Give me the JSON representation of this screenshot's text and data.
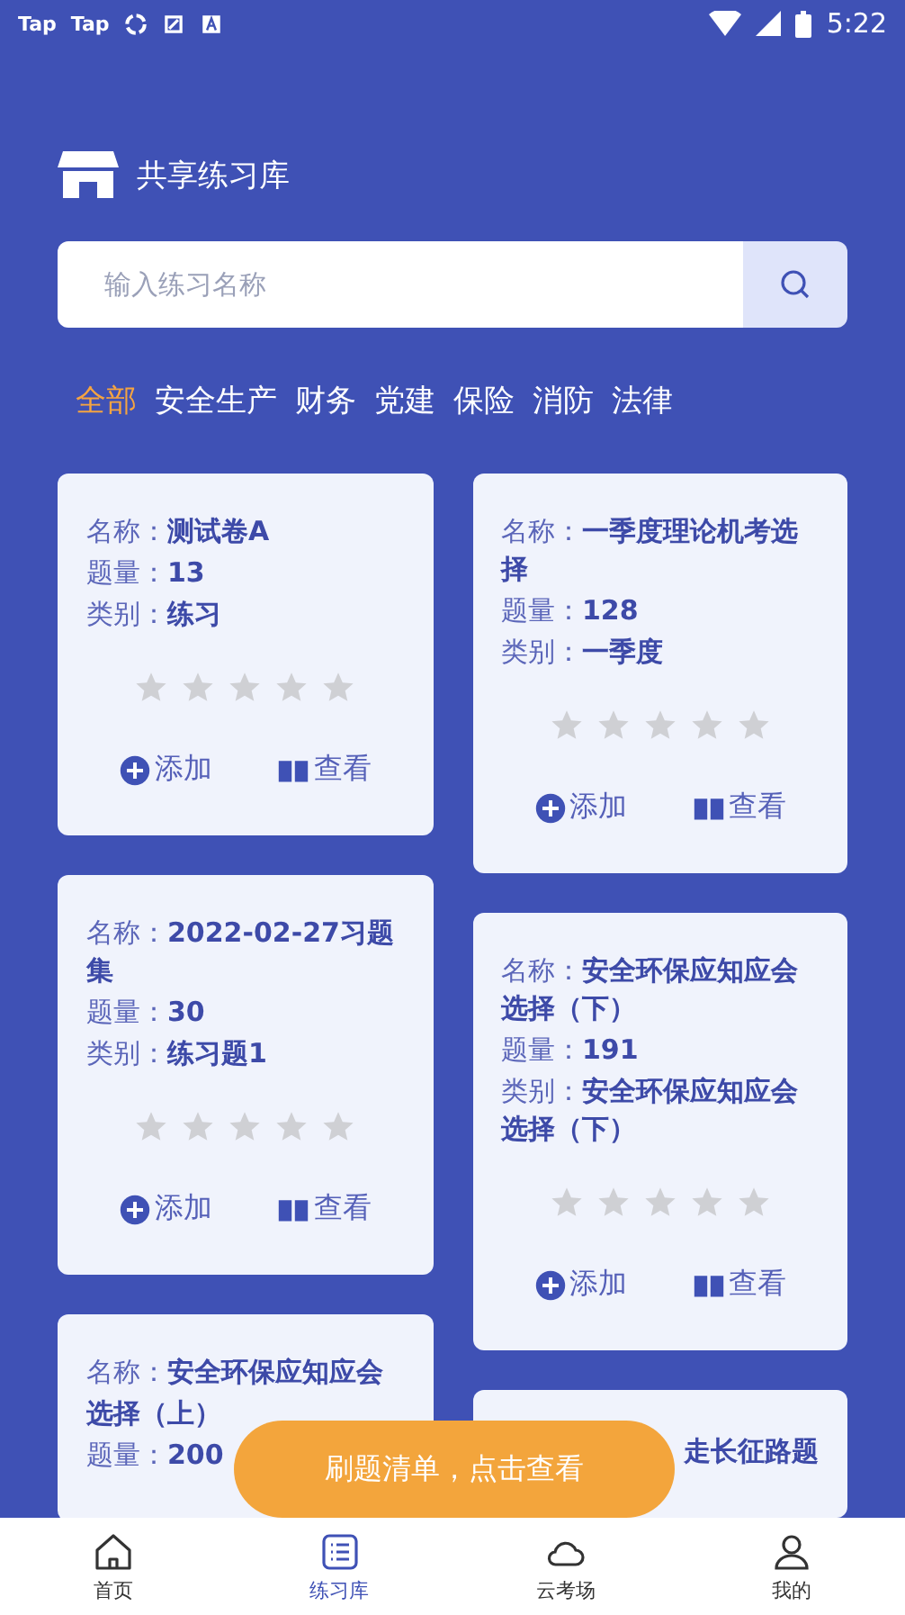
{
  "status_bar": {
    "left": [
      "Tap",
      "Tap"
    ],
    "time": "5:22"
  },
  "header": {
    "title": "共享练习库"
  },
  "search": {
    "placeholder": "输入练习名称"
  },
  "filters": [
    {
      "label": "全部",
      "selected": true
    },
    {
      "label": "安全生产",
      "selected": false
    },
    {
      "label": "财务",
      "selected": false
    },
    {
      "label": "党建",
      "selected": false
    },
    {
      "label": "保险",
      "selected": false
    },
    {
      "label": "消防",
      "selected": false
    },
    {
      "label": "法律",
      "selected": false
    }
  ],
  "cards": [
    {
      "kind": "full",
      "lines": [
        "名称：**测试卷A**",
        "题量：**13**",
        "类别：**练习**"
      ],
      "stars": 0,
      "actions": [
        {
          "kind": "add",
          "label": "添加"
        },
        {
          "kind": "view",
          "label": "查看"
        }
      ]
    },
    {
      "kind": "full",
      "lines": [
        "名称：**一季度理论机考选择**",
        "题量：**128**",
        "类别：**一季度**"
      ],
      "stars": 0,
      "actions": [
        {
          "kind": "add",
          "label": "添加"
        },
        {
          "kind": "view",
          "label": "查看"
        }
      ]
    },
    {
      "kind": "full",
      "lines": [
        "名称：**2022-02-27习题集**",
        "题量：**30**",
        "类别：**练习题1**"
      ],
      "stars": 0,
      "actions": [
        {
          "kind": "add",
          "label": "添加"
        },
        {
          "kind": "view",
          "label": "查看"
        }
      ]
    },
    {
      "kind": "full",
      "lines": [
        "名称：**安全环保应知应会选择（下）**",
        "题量：**191**",
        "类别：**安全环保应知应会选择（下）**"
      ],
      "stars": 0,
      "actions": [
        {
          "kind": "add",
          "label": "添加"
        },
        {
          "kind": "view",
          "label": "查看"
        }
      ]
    },
    {
      "kind": "full",
      "lines": [
        "名称：**安全环保应知应会**",
        "**选择（上）**",
        "题量：**200**"
      ]
    },
    {
      "kind": "partial",
      "lines": [
        "**走长征路题**"
      ]
    }
  ],
  "toast": {
    "label": "刷题清单，点击查看"
  },
  "tabs": [
    {
      "kind": "home",
      "label": "首页",
      "selected": false
    },
    {
      "kind": "list",
      "label": "练习库",
      "selected": true
    },
    {
      "kind": "cloud",
      "label": "云考场",
      "selected": false
    },
    {
      "kind": "user",
      "label": "我的",
      "selected": false
    }
  ]
}
